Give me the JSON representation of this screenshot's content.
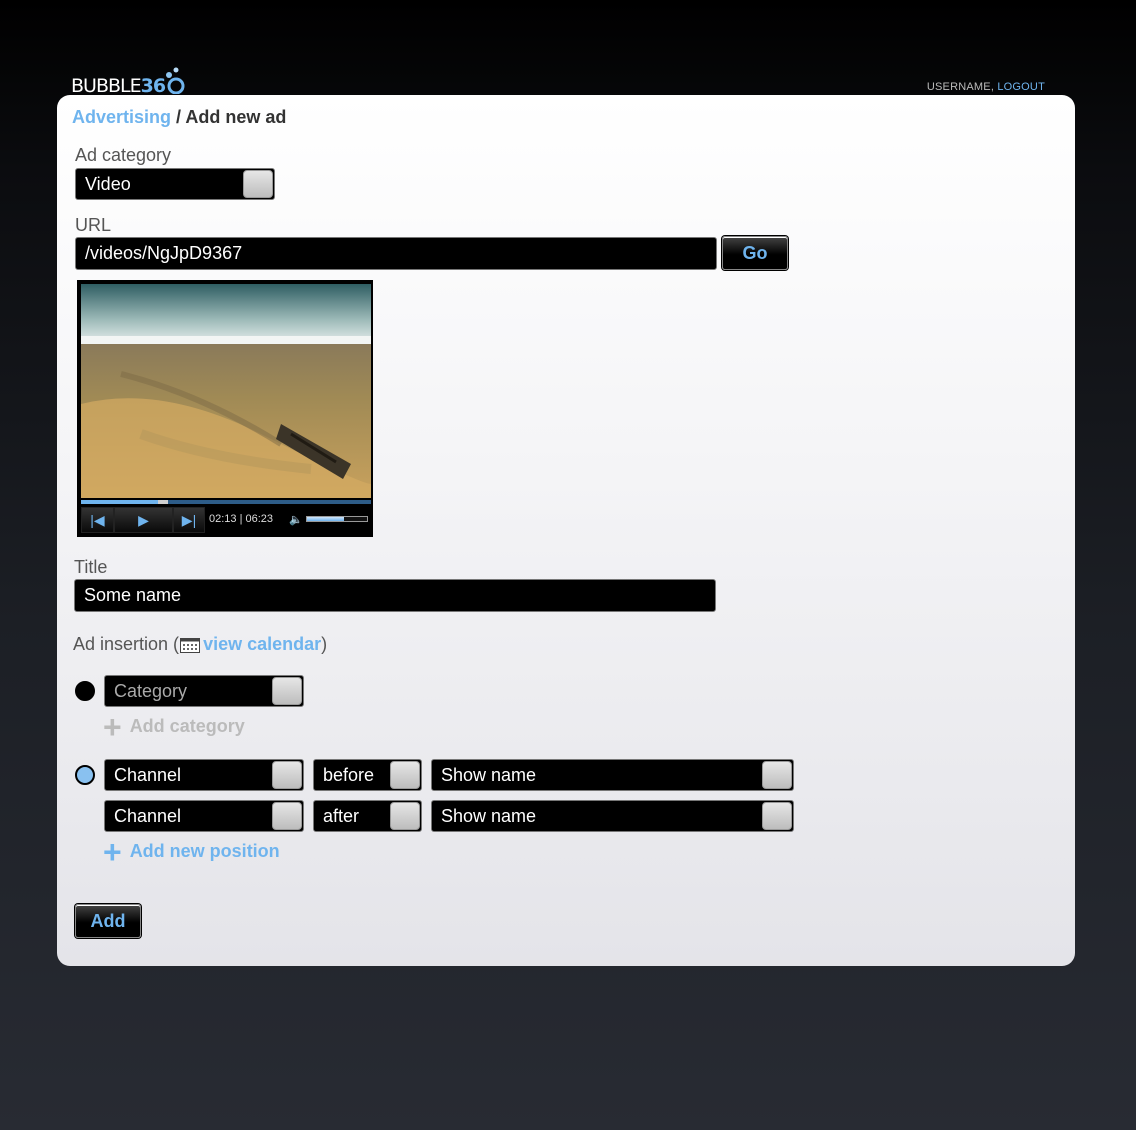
{
  "header": {
    "logo_word": "BUBBLE",
    "logo_number": "36",
    "username": "USERNAME,",
    "logout": "LOGOUT"
  },
  "breadcrumb": {
    "parent": "Advertising",
    "separator": " / ",
    "current": "Add new ad"
  },
  "ad_category": {
    "label": "Ad category",
    "value": "Video"
  },
  "url": {
    "label": "URL",
    "value": "/videos/NgJpD9367",
    "go_label": "Go"
  },
  "video": {
    "time": "02:13 | 06:23",
    "progress": 0.3,
    "volume": 0.62
  },
  "title_field": {
    "label": "Title",
    "value": "Some name"
  },
  "insertion": {
    "label": "Ad insertion (",
    "calendar_link": "view calendar",
    "close_paren": ")",
    "category_option": {
      "select_value": "Category",
      "add_label": "Add category"
    },
    "channel_option": {
      "rows": [
        {
          "channel": "Channel",
          "relation": "before",
          "show": "Show name"
        },
        {
          "channel": "Channel",
          "relation": "after",
          "show": "Show name"
        }
      ],
      "add_label": "Add new position"
    }
  },
  "submit_label": "Add",
  "colors": {
    "accent": "#6fb4ee",
    "field_bg": "#000000",
    "disabled": "#bbbbbb"
  }
}
